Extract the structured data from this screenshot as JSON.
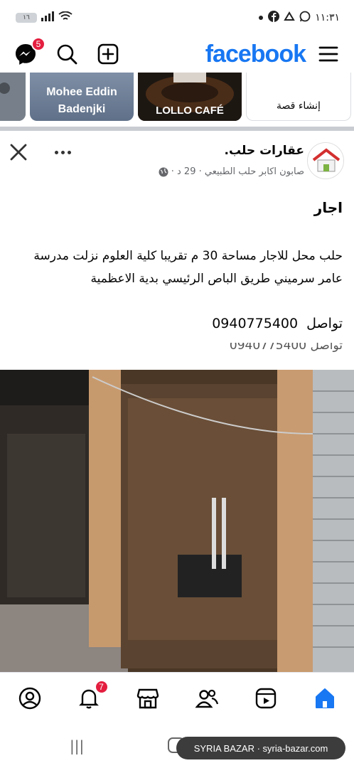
{
  "status_bar": {
    "time": "١١:٣١",
    "battery": "١٦"
  },
  "app_bar": {
    "logo": "facebook",
    "messenger_badge": "5",
    "icons": [
      "messenger-icon",
      "search-icon",
      "create-plus-icon",
      "menu-icon"
    ]
  },
  "stories": [
    {
      "name": "Mohee Eddin Badenjki"
    },
    {
      "name": "LOLLO CAFÉ"
    },
    {
      "label": "إنشاء قصة"
    }
  ],
  "post": {
    "page_name": "عقارات حلب.",
    "meta": "صابون اكابر حلب الطبيعي · 29 د ·",
    "title": "اجار",
    "body": "حلب محل للاجار مساحة 30 م تقريبا كلية العلوم نزلت مدرسة عامر سرميني طريق الباص الرئيسي بدية الاعظمية",
    "contact_label": "تواصل",
    "contact_phone": "0940775400",
    "ghost_text": "تواصل 0940775400"
  },
  "bottom_nav": {
    "items": [
      "profile-icon",
      "notifications-icon",
      "marketplace-icon",
      "friends-icon",
      "video-icon",
      "home-icon"
    ],
    "notifications_badge": "7"
  },
  "watermark": "SYRIA BAZAR · syria-bazar.com",
  "colors": {
    "brand": "#1877f2",
    "badge": "#e41e3f"
  }
}
